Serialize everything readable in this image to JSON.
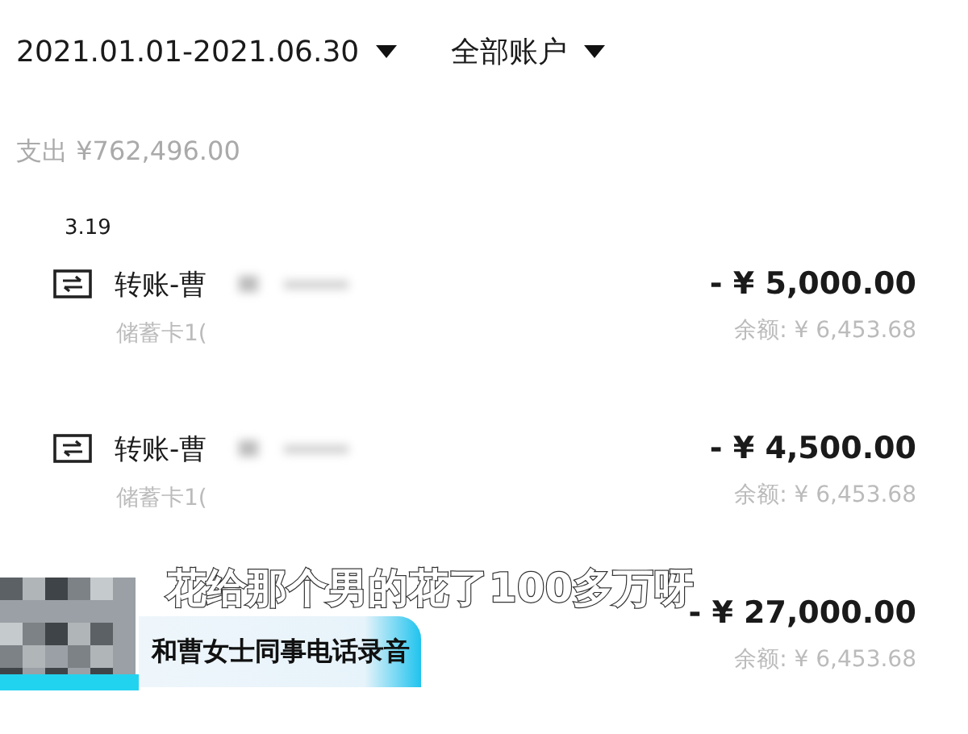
{
  "filters": [
    {
      "label": "2021.01.01-2021.06.30"
    },
    {
      "label": "全部账户"
    }
  ],
  "summary": "支出 ¥762,496.00",
  "date": "3.19",
  "transactions": [
    {
      "kind": "full",
      "title": "转账-曹",
      "account": "储蓄卡1(",
      "amount": "- ¥ 5,000.00",
      "balance": "余额: ¥ 6,453.68"
    },
    {
      "kind": "full",
      "title": "转账-曹",
      "account": "储蓄卡1(",
      "amount": "- ¥ 4,500.00",
      "balance": "余额: ¥ 6,453.68"
    },
    {
      "kind": "covered",
      "amount": "- ¥ 27,000.00",
      "balance": "余额: ¥ 6,453.68"
    }
  ],
  "subtitle": "花给那个男的花了100多万呀",
  "caption": "和曹女士同事电话录音"
}
